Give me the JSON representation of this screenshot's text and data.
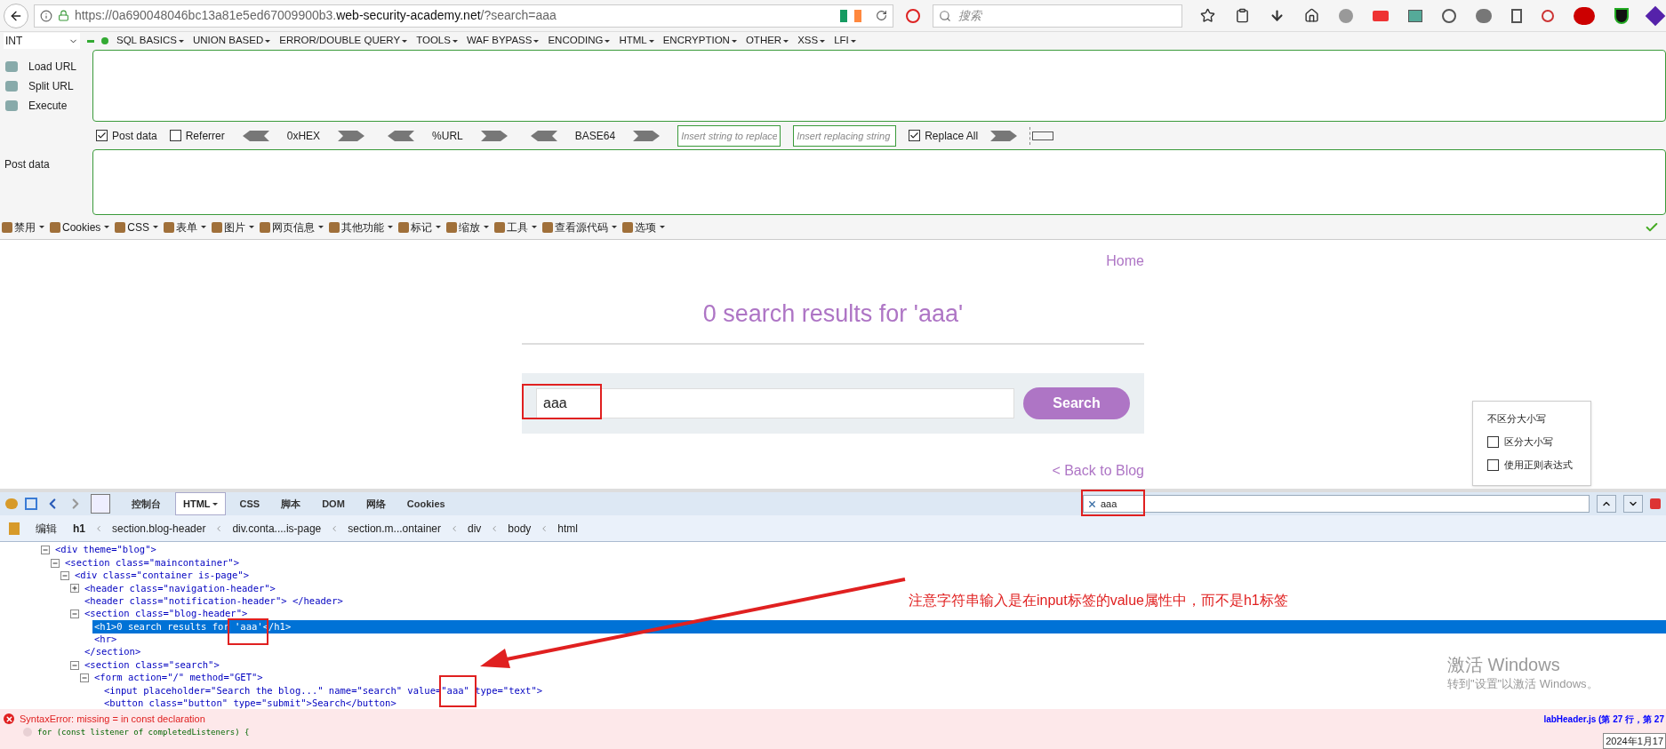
{
  "browser": {
    "url_prefix": "https://0a690048046bc13a81e5ed67009900b3.",
    "url_domain": "web-security-academy.net",
    "url_suffix": "/?search=aaa",
    "search_placeholder": "搜索"
  },
  "hackbar": {
    "mode": "INT",
    "menus": [
      "SQL BASICS",
      "UNION BASED",
      "ERROR/DOUBLE QUERY",
      "TOOLS",
      "WAF BYPASS",
      "ENCODING",
      "HTML",
      "ENCRYPTION",
      "OTHER",
      "XSS",
      "LFI"
    ],
    "actions": [
      "Load URL",
      "Split URL",
      "Execute"
    ],
    "options": [
      {
        "kind": "check",
        "label": "Post data",
        "checked": true
      },
      {
        "kind": "check",
        "label": "Referrer",
        "checked": false
      },
      {
        "kind": "encode",
        "label": "0xHEX"
      },
      {
        "kind": "encode",
        "label": "%URL"
      },
      {
        "kind": "encode",
        "label": "BASE64"
      },
      {
        "kind": "field",
        "placeholder": "Insert string to replace"
      },
      {
        "kind": "field",
        "placeholder": "Insert replacing string"
      },
      {
        "kind": "check",
        "label": "Replace All",
        "checked": true
      }
    ],
    "post_label": "Post data"
  },
  "webdev_toolbar": [
    "禁用",
    "Cookies",
    "CSS",
    "表单",
    "图片",
    "网页信息",
    "其他功能",
    "标记",
    "缩放",
    "工具",
    "查看源代码",
    "选项"
  ],
  "page": {
    "home": "Home",
    "heading": "0 search results for 'aaa'",
    "search_value": "aaa",
    "search_button": "Search",
    "back": "< Back to Blog"
  },
  "find_popup": {
    "title": "不区分大小写",
    "options": [
      {
        "label": "区分大小写",
        "checked": false
      },
      {
        "label": "使用正则表达式",
        "checked": false
      }
    ]
  },
  "devtools": {
    "tabs": [
      {
        "label": "控制台",
        "selected": false
      },
      {
        "label": "HTML",
        "selected": true
      },
      {
        "label": "CSS",
        "selected": false
      },
      {
        "label": "脚本",
        "selected": false
      },
      {
        "label": "DOM",
        "selected": false
      },
      {
        "label": "网络",
        "selected": false
      },
      {
        "label": "Cookies",
        "selected": false
      }
    ],
    "find_value": "aaa",
    "edit": "编辑",
    "breadcrumbs": [
      "h1",
      "section.blog-header",
      "div.conta....is-page",
      "section.m...ontainer",
      "div",
      "body",
      "html"
    ],
    "lines": [
      {
        "text": "<div theme=\"blog\">",
        "expanded": true,
        "selected": false,
        "children": [
          {
            "text": "<section class=\"maincontainer\">",
            "expanded": true,
            "selected": false,
            "children": [
              {
                "text": "<div class=\"container is-page\">",
                "expanded": true,
                "selected": false,
                "children": [
                  {
                    "text": "<header class=\"navigation-header\">",
                    "expanded": false,
                    "selected": false
                  },
                  {
                    "text": "<header class=\"notification-header\"> </header>",
                    "selected": false
                  },
                  {
                    "text": "<section class=\"blog-header\">",
                    "expanded": true,
                    "selected": false,
                    "children": [
                      {
                        "text": "<h1>0 search results for 'aaa'</h1>",
                        "selected": true
                      },
                      {
                        "text": "<hr>",
                        "selected": false
                      }
                    ]
                  },
                  {
                    "text": "</section>",
                    "selected": false
                  },
                  {
                    "text": "<section class=\"search\">",
                    "expanded": true,
                    "selected": false,
                    "children": [
                      {
                        "text": "<form action=\"/\" method=\"GET\">",
                        "expanded": true,
                        "selected": false,
                        "children": [
                          {
                            "text": "<input placeholder=\"Search the blog...\" name=\"search\" value=\"aaa\" type=\"text\">",
                            "selected": false
                          },
                          {
                            "text": "<button class=\"button\" type=\"submit\">Search</button>",
                            "selected": false
                          }
                        ]
                      }
                    ]
                  }
                ]
              }
            ]
          }
        ]
      }
    ],
    "annotation": "注意字符串输入是在input标签的value属性中，而不是h1标签",
    "error": {
      "message": "SyntaxError: missing = in const declaration",
      "code": "for (const listener of completedListeners) {",
      "source": "labHeader.js (第 27 行，第 27"
    }
  },
  "os": {
    "activate_title": "激活 Windows",
    "activate_sub": "转到\"设置\"以激活 Windows。",
    "date": "2024年1月17"
  }
}
